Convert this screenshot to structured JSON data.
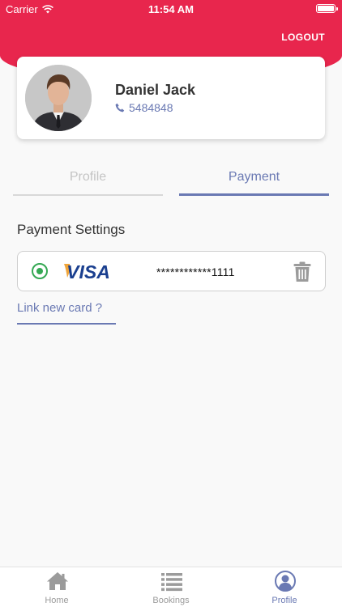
{
  "status_bar": {
    "carrier": "Carrier",
    "time": "11:54 AM"
  },
  "header": {
    "logout_label": "LOGOUT",
    "accent_color": "#e8264d"
  },
  "profile": {
    "name": "Daniel Jack",
    "phone": "5484848"
  },
  "tabs": [
    {
      "label": "Profile",
      "active": false
    },
    {
      "label": "Payment",
      "active": true
    }
  ],
  "payment": {
    "section_title": "Payment Settings",
    "cards": [
      {
        "brand": "VISA",
        "number_masked": "************1111",
        "selected": true
      }
    ],
    "link_new_card": "Link new card ?"
  },
  "bottom_nav": [
    {
      "label": "Home",
      "icon": "home-icon",
      "active": false
    },
    {
      "label": "Bookings",
      "icon": "list-icon",
      "active": false
    },
    {
      "label": "Profile",
      "icon": "user-icon",
      "active": true
    }
  ],
  "colors": {
    "primary": "#6a79b3",
    "accent": "#e8264d",
    "success": "#34a853"
  }
}
